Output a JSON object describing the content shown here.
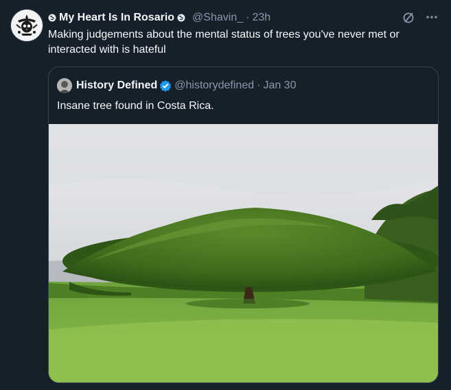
{
  "tweet": {
    "display_name": "My Heart Is In Rosario",
    "handle": "@Shavin_",
    "separator": "·",
    "time": "23h",
    "text": "Making judgements about the mental status of trees you've never met or interacted with is hateful"
  },
  "quoted": {
    "display_name": "History Defined",
    "handle": "@historydefined",
    "separator": "·",
    "date": "Jan 30",
    "text": "Insane tree found in Costa Rica.",
    "verified": true
  },
  "icons": {
    "name_prefix": "globe-icon",
    "name_suffix": "globe-icon",
    "grok": "slash-circle-icon",
    "more": "more-horizontal-icon",
    "verified": "verified-badge-icon"
  },
  "colors": {
    "background": "#15202b",
    "text": "#f7f9f9",
    "muted": "#8b98a5",
    "border": "#38444d",
    "verified": "#1d9bf0"
  }
}
